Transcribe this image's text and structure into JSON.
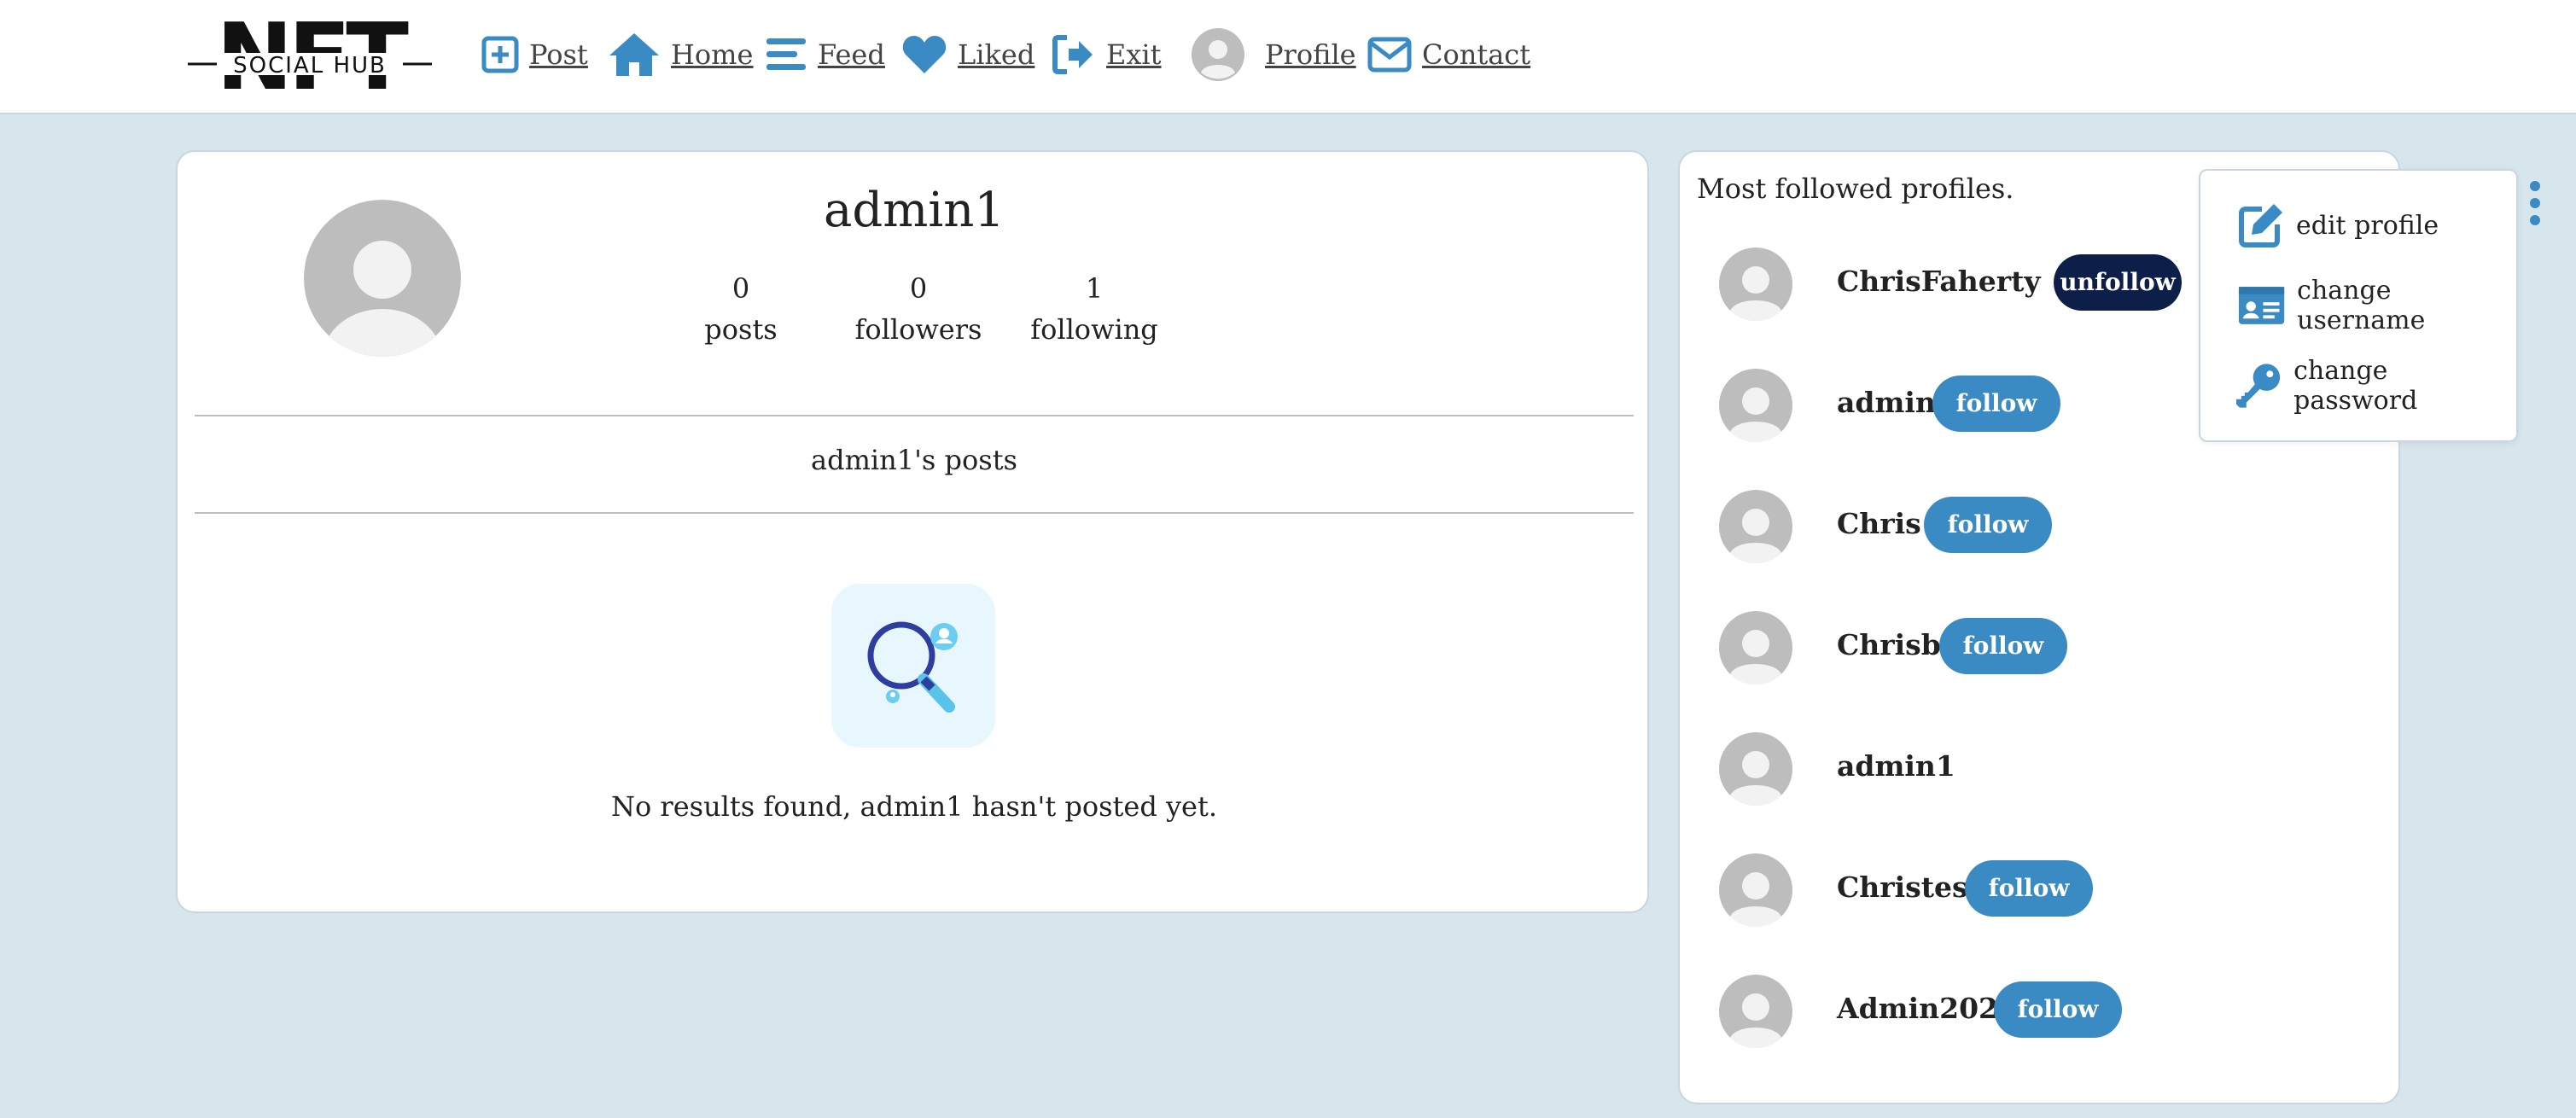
{
  "logo": {
    "top_text": "NFT",
    "sub_text": "SOCIAL HUB"
  },
  "nav": {
    "post": "Post",
    "home": "Home",
    "feed": "Feed",
    "liked": "Liked",
    "exit": "Exit",
    "profile": "Profile",
    "contact": "Contact"
  },
  "profile": {
    "username": "admin1",
    "stats": [
      {
        "count": "0",
        "label": "posts"
      },
      {
        "count": "0",
        "label": "followers"
      },
      {
        "count": "1",
        "label": "following"
      }
    ],
    "posts_title": "admin1's posts",
    "empty_message": "No results found, admin1 hasn't posted yet."
  },
  "sidebar": {
    "title": "Most followed profiles.",
    "profiles": [
      {
        "name": "ChrisFaherty",
        "action": "unfollow"
      },
      {
        "name": "admin",
        "action": "follow"
      },
      {
        "name": "Chris",
        "action": "follow"
      },
      {
        "name": "Chrisb",
        "action": "follow"
      },
      {
        "name": "admin1",
        "action": ""
      },
      {
        "name": "Christest",
        "action": "follow"
      },
      {
        "name": "Admin2023",
        "action": "follow"
      }
    ]
  },
  "menu": {
    "items": [
      {
        "label": "edit profile",
        "icon": "pen-square-icon"
      },
      {
        "label": "change username",
        "icon": "id-card-icon"
      },
      {
        "label": "change password",
        "icon": "key-icon"
      }
    ]
  },
  "colors": {
    "accent": "#3a8ac4",
    "dark": "#0d1f48",
    "background": "#d7e5ec"
  }
}
